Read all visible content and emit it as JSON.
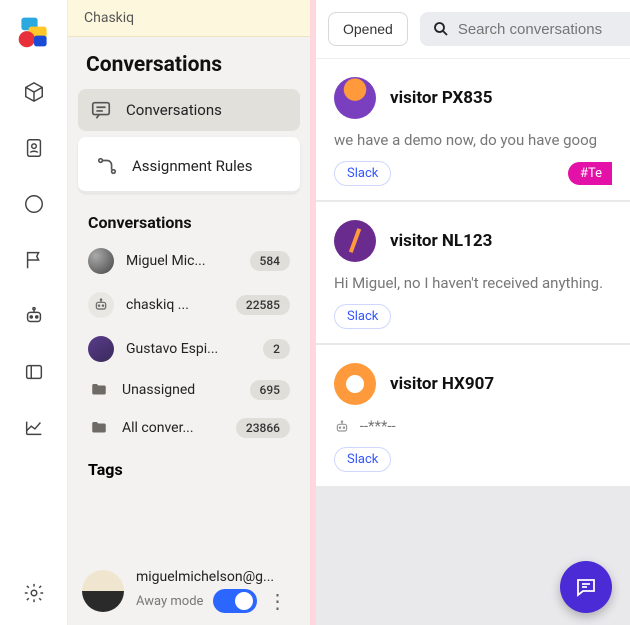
{
  "workspace_name": "Chaskiq",
  "sidebar": {
    "title": "Conversations",
    "nav": [
      {
        "label": "Conversations"
      },
      {
        "label": "Assignment Rules"
      }
    ],
    "section_header": "Conversations",
    "items": [
      {
        "name": "Miguel Mic...",
        "count": "584"
      },
      {
        "name": "chaskiq ...",
        "count": "22585"
      },
      {
        "name": "Gustavo Espi...",
        "count": "2"
      },
      {
        "name": "Unassigned",
        "count": "695"
      },
      {
        "name": "All conver...",
        "count": "23866"
      }
    ],
    "tags_header": "Tags"
  },
  "user_footer": {
    "email": "miguelmichelson@g...",
    "away_label": "Away mode"
  },
  "topbar": {
    "filter_label": "Opened",
    "search_placeholder": "Search conversations"
  },
  "conversations": [
    {
      "name": "visitor PX835",
      "preview": "we have a demo now, do you have goog",
      "pill": "Slack",
      "tag": "#Te"
    },
    {
      "name": "visitor NL123",
      "preview": "Hi Miguel, no I haven't received anything.",
      "pill": "Slack"
    },
    {
      "name": "visitor HX907",
      "preview": "--***--",
      "pill": "Slack",
      "bot": true
    }
  ]
}
